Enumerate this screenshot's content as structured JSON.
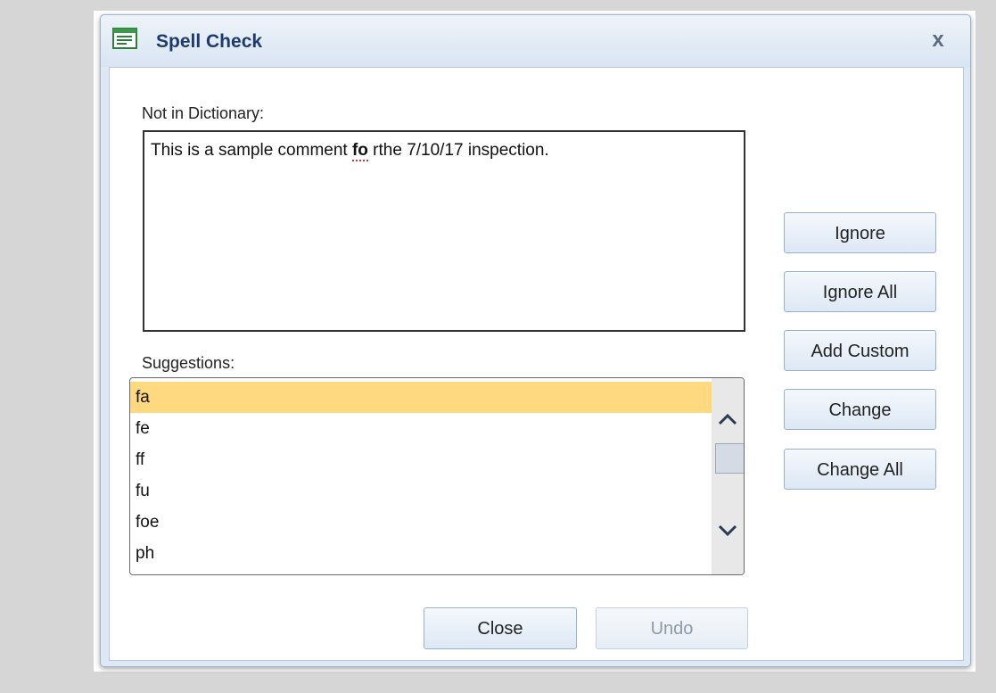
{
  "dialog": {
    "title": "Spell Check",
    "close_glyph": "x",
    "title_icon": "document-icon"
  },
  "not_in_dictionary": {
    "label": "Not in Dictionary:",
    "text_before": "This is a sample comment ",
    "misspelled": "fo",
    "text_after": " rthe 7/10/17 inspection."
  },
  "suggestions": {
    "label": "Suggestions:",
    "items": [
      "fa",
      "fe",
      "ff",
      "fu",
      "foe",
      "ph"
    ],
    "selected_index": 0
  },
  "buttons": {
    "ignore": "Ignore",
    "ignore_all": "Ignore All",
    "add_custom": "Add Custom",
    "change": "Change",
    "change_all": "Change All",
    "close": "Close",
    "undo": "Undo"
  },
  "colors": {
    "title_text": "#1e3a6e",
    "selection": "#ffd980",
    "misspell_underline": "#e03030"
  }
}
